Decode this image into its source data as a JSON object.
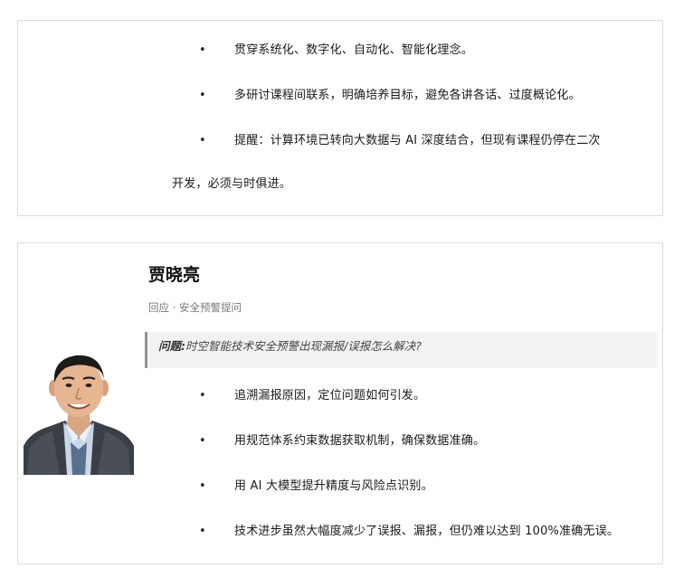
{
  "post_top": {
    "bullets": [
      "贯穿系统化、数字化、自动化、智能化理念。",
      "多研讨课程间联系，明确培养目标，避免各讲各话、过度概论化。",
      "提醒：计算环境已转向大数据与 AI 深度结合，但现有课程仍停在二次"
    ],
    "continuation": "开发，必须与时俱进。",
    "bullet_symbol": "•"
  },
  "post_bottom": {
    "author": "贾晓亮",
    "meta": "回应 · 安全预警提问",
    "question_label": "问题:",
    "question_text": "时空智能技术安全预警出现漏报/误报怎么解决?",
    "bullets": [
      "追溯漏报原因，定位问题如何引发。",
      "用规范体系约束数据获取机制，确保数据准确。",
      "用 AI 大模型提升精度与风险点识别。",
      "技术进步虽然大幅度减少了误报、漏报，但仍难以达到 100%准确无误。"
    ],
    "bullet_symbol": "•",
    "avatar_icon": "person-portrait-icon"
  },
  "colors": {
    "card_border": "#dcdcdc",
    "question_bg": "#f1f2f3",
    "question_bar": "#8e9196",
    "text": "#1a1a1a",
    "meta_text": "#777777"
  }
}
